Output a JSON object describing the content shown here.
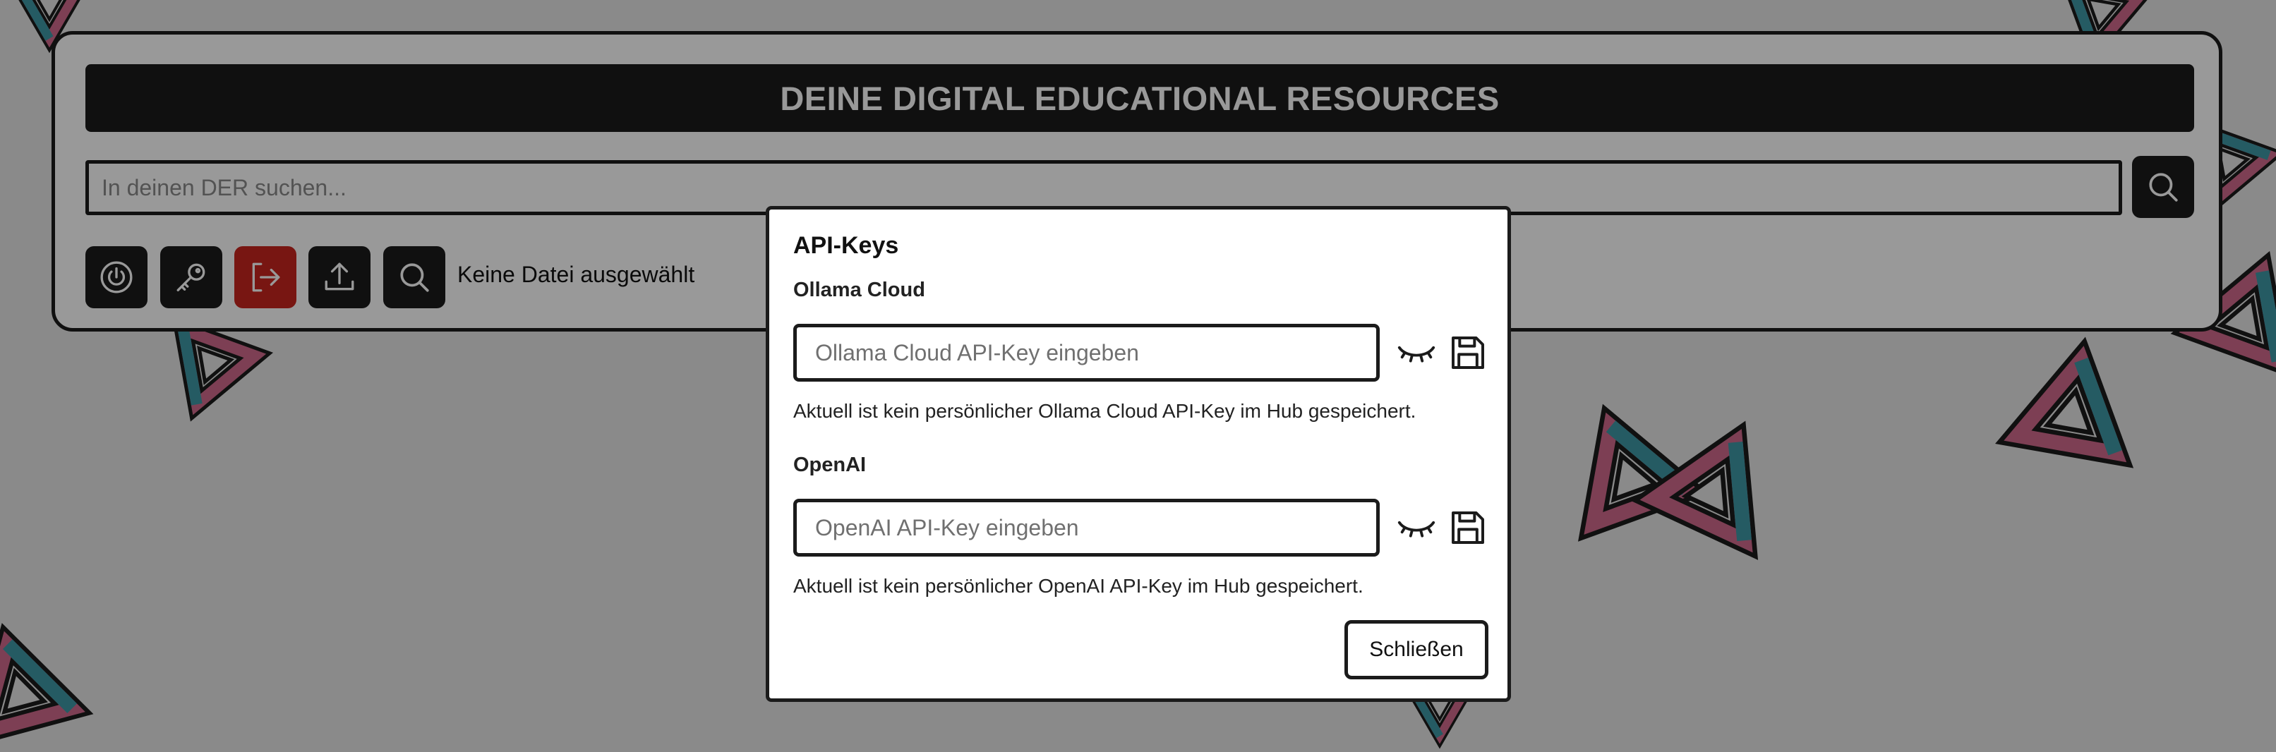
{
  "header": {
    "title": "DEINE DIGITAL EDUCATIONAL RESOURCES"
  },
  "search": {
    "placeholder": "In deinen DER suchen...",
    "button_icon": "search-icon"
  },
  "toolbar": {
    "buttons": [
      {
        "icon": "power-icon"
      },
      {
        "icon": "key-icon"
      },
      {
        "icon": "logout-icon",
        "color": "#c8261e"
      },
      {
        "icon": "upload-icon"
      },
      {
        "icon": "search-icon"
      }
    ],
    "file_status": "Keine Datei ausgewählt"
  },
  "modal": {
    "title": "API-Keys",
    "providers": [
      {
        "label": "Ollama Cloud",
        "placeholder": "Ollama Cloud API-Key eingeben",
        "status": "Aktuell ist kein persönlicher Ollama Cloud API-Key im Hub gespeichert."
      },
      {
        "label": "OpenAI",
        "placeholder": "OpenAI API-Key eingeben",
        "status": "Aktuell ist kein persönlicher OpenAI API-Key im Hub gespeichert."
      }
    ],
    "close_label": "Schließen"
  },
  "colors": {
    "dark": "#1b1b1b",
    "accent_red": "#c8261e",
    "background": "#e6e6e6",
    "shape_pink": "#d16a8c",
    "shape_teal": "#3f98a6"
  }
}
